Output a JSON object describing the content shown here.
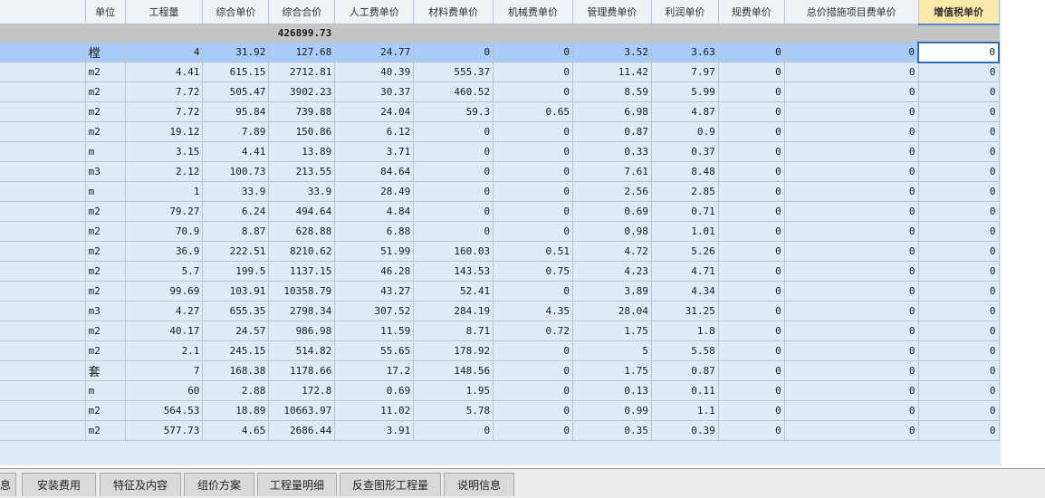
{
  "columns": [
    "单位",
    "工程量",
    "综合单价",
    "综合合价",
    "人工费单价",
    "材料费单价",
    "机械费单价",
    "管理费单价",
    "利润单价",
    "规费单价",
    "总价措施项目费单价",
    "增值税单价"
  ],
  "active_column_index": 11,
  "total_row": {
    "label": "426899.73"
  },
  "rows": [
    [
      "樘",
      "4",
      "31.92",
      "127.68",
      "24.77",
      "0",
      "0",
      "3.52",
      "3.63",
      "0",
      "0",
      "0"
    ],
    [
      "m2",
      "4.41",
      "615.15",
      "2712.81",
      "40.39",
      "555.37",
      "0",
      "11.42",
      "7.97",
      "0",
      "0",
      "0"
    ],
    [
      "m2",
      "7.72",
      "505.47",
      "3902.23",
      "30.37",
      "460.52",
      "0",
      "8.59",
      "5.99",
      "0",
      "0",
      "0"
    ],
    [
      "m2",
      "7.72",
      "95.84",
      "739.88",
      "24.04",
      "59.3",
      "0.65",
      "6.98",
      "4.87",
      "0",
      "0",
      "0"
    ],
    [
      "m2",
      "19.12",
      "7.89",
      "150.86",
      "6.12",
      "0",
      "0",
      "0.87",
      "0.9",
      "0",
      "0",
      "0"
    ],
    [
      "m",
      "3.15",
      "4.41",
      "13.89",
      "3.71",
      "0",
      "0",
      "0.33",
      "0.37",
      "0",
      "0",
      "0"
    ],
    [
      "m3",
      "2.12",
      "100.73",
      "213.55",
      "84.64",
      "0",
      "0",
      "7.61",
      "8.48",
      "0",
      "0",
      "0"
    ],
    [
      "m",
      "1",
      "33.9",
      "33.9",
      "28.49",
      "0",
      "0",
      "2.56",
      "2.85",
      "0",
      "0",
      "0"
    ],
    [
      "m2",
      "79.27",
      "6.24",
      "494.64",
      "4.84",
      "0",
      "0",
      "0.69",
      "0.71",
      "0",
      "0",
      "0"
    ],
    [
      "m2",
      "70.9",
      "8.87",
      "628.88",
      "6.88",
      "0",
      "0",
      "0.98",
      "1.01",
      "0",
      "0",
      "0"
    ],
    [
      "m2",
      "36.9",
      "222.51",
      "8210.62",
      "51.99",
      "160.03",
      "0.51",
      "4.72",
      "5.26",
      "0",
      "0",
      "0"
    ],
    [
      "m2",
      "5.7",
      "199.5",
      "1137.15",
      "46.28",
      "143.53",
      "0.75",
      "4.23",
      "4.71",
      "0",
      "0",
      "0"
    ],
    [
      "m2",
      "99.69",
      "103.91",
      "10358.79",
      "43.27",
      "52.41",
      "0",
      "3.89",
      "4.34",
      "0",
      "0",
      "0"
    ],
    [
      "m3",
      "4.27",
      "655.35",
      "2798.34",
      "307.52",
      "284.19",
      "4.35",
      "28.04",
      "31.25",
      "0",
      "0",
      "0"
    ],
    [
      "m2",
      "40.17",
      "24.57",
      "986.98",
      "11.59",
      "8.71",
      "0.72",
      "1.75",
      "1.8",
      "0",
      "0",
      "0"
    ],
    [
      "m2",
      "2.1",
      "245.15",
      "514.82",
      "55.65",
      "178.92",
      "0",
      "5",
      "5.58",
      "0",
      "0",
      "0"
    ],
    [
      "套",
      "7",
      "168.38",
      "1178.66",
      "17.2",
      "148.56",
      "0",
      "1.75",
      "0.87",
      "0",
      "0",
      "0"
    ],
    [
      "m",
      "60",
      "2.88",
      "172.8",
      "0.69",
      "1.95",
      "0",
      "0.13",
      "0.11",
      "0",
      "0",
      "0"
    ],
    [
      "m2",
      "564.53",
      "18.89",
      "10663.97",
      "11.02",
      "5.78",
      "0",
      "0.99",
      "1.1",
      "0",
      "0",
      "0"
    ],
    [
      "m2",
      "577.73",
      "4.65",
      "2686.44",
      "3.91",
      "0",
      "0",
      "0.35",
      "0.39",
      "0",
      "0",
      "0"
    ]
  ],
  "selected_row_index": 0,
  "tabs": [
    "息",
    "安装费用",
    "特征及内容",
    "组价方案",
    "工程量明细",
    "反查图形工程量",
    "说明信息"
  ],
  "colors": {
    "grid_bg": "#dfeaf9",
    "selected_row": "#a8cbf7",
    "total_row": "#c4c4c4",
    "active_header": "#fbe9a9"
  }
}
